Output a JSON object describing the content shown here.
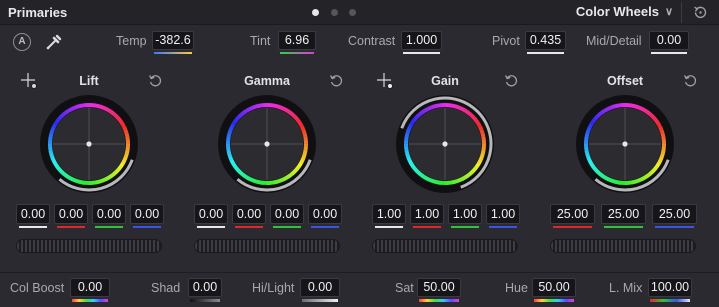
{
  "header": {
    "title": "Primaries",
    "mode": "Color Wheels",
    "icons": [
      "chevron-down-icon",
      "reset-all-icon"
    ]
  },
  "controls": {
    "auto_label": "A",
    "temp_label": "Temp",
    "temp_value": "-382.6",
    "tint_label": "Tint",
    "tint_value": "6.96",
    "contrast_label": "Contrast",
    "contrast_value": "1.000",
    "pivot_label": "Pivot",
    "pivot_value": "0.435",
    "middetail_label": "Mid/Detail",
    "middetail_value": "0.00"
  },
  "wheels": {
    "lift": {
      "title": "Lift",
      "values": [
        "0.00",
        "0.00",
        "0.00",
        "0.00"
      ]
    },
    "gamma": {
      "title": "Gamma",
      "values": [
        "0.00",
        "0.00",
        "0.00",
        "0.00"
      ]
    },
    "gain": {
      "title": "Gain",
      "values": [
        "1.00",
        "1.00",
        "1.00",
        "1.00"
      ]
    },
    "offset": {
      "title": "Offset",
      "values": [
        "25.00",
        "25.00",
        "25.00"
      ]
    }
  },
  "bottom": {
    "colboost_label": "Col Boost",
    "colboost_value": "0.00",
    "shad_label": "Shad",
    "shad_value": "0.00",
    "hilight_label": "Hi/Light",
    "hilight_value": "0.00",
    "sat_label": "Sat",
    "sat_value": "50.00",
    "hue_label": "Hue",
    "hue_value": "50.00",
    "lmix_label": "L. Mix",
    "lmix_value": "100.00"
  },
  "colors": {
    "y": "#e8e8ec",
    "r": "#e0262a",
    "g": "#2fc33a",
    "b": "#3a54e8"
  }
}
